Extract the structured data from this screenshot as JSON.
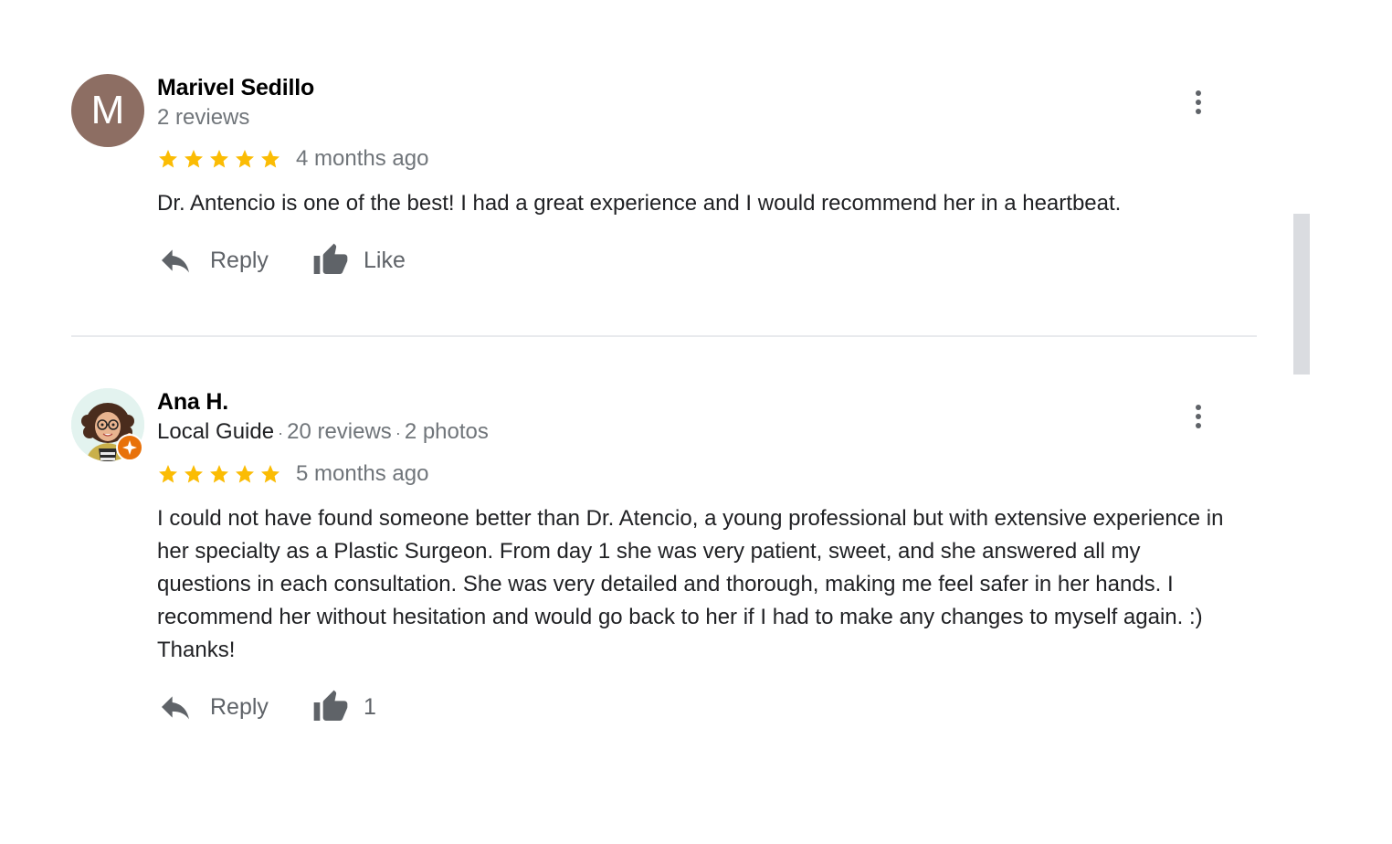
{
  "colors": {
    "star": "#fbbc04",
    "avatar_letter_bg": "#8d6e63",
    "guide_badge": "#e8710a",
    "icon_gray": "#5f6368"
  },
  "reviews": [
    {
      "avatar_letter": "M",
      "author": "Marivel Sedillo",
      "reviews_count": "2 reviews",
      "rating": 5,
      "date": "4 months ago",
      "text": "Dr. Antencio is one of the best! I had a great experience and I would recommend her in a heartbeat.",
      "reply_label": "Reply",
      "like_label": "Like",
      "more_icon": "more-vert-icon"
    },
    {
      "author": "Ana H.",
      "local_guide": "Local Guide",
      "reviews_count": "20 reviews",
      "photos_count": "2 photos",
      "separator": "·",
      "rating": 5,
      "date": "5 months ago",
      "text": "I could not have found someone better than Dr. Atencio, a young professional but with extensive experience in her specialty as a Plastic Surgeon. From day 1 she was very patient, sweet, and she answered all my questions in each consultation. She was very detailed and thorough, making me feel safer in her hands. I recommend her without hesitation and would go back to her if I had to make any changes to myself again. :)\nThanks!",
      "reply_label": "Reply",
      "like_count": "1",
      "more_icon": "more-vert-icon"
    }
  ]
}
